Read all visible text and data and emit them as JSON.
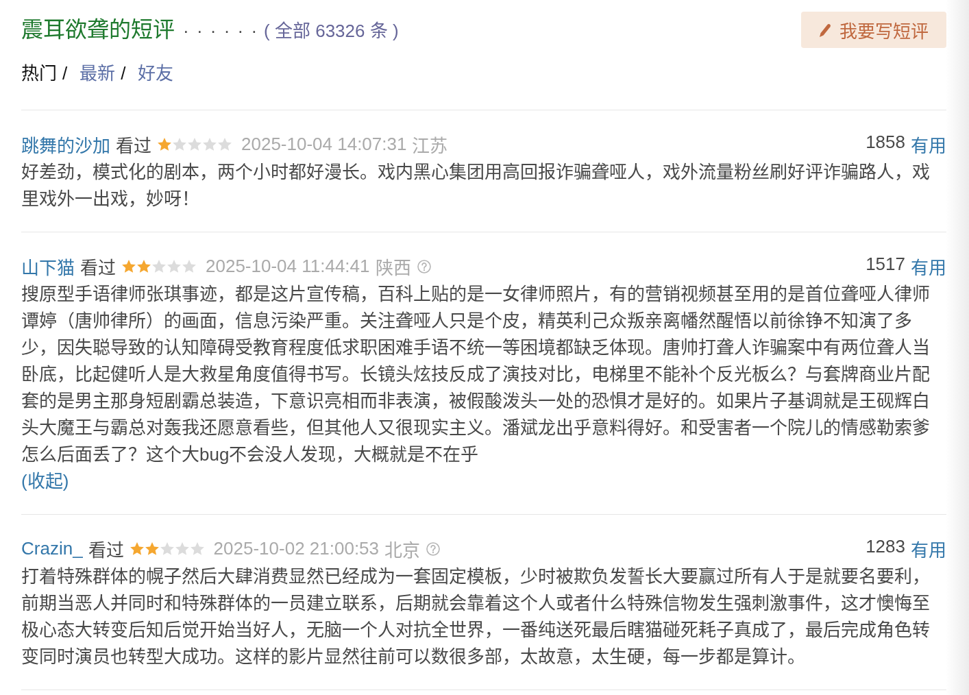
{
  "header": {
    "title": "震耳欲聋的短评",
    "leader": "· · · · · ·",
    "all_link": "( 全部 63326 条 )",
    "write_button": "我要写短评"
  },
  "tabs": [
    {
      "label": "热门",
      "selected": true,
      "separator": "/"
    },
    {
      "label": "最新",
      "selected": false,
      "separator": "/"
    },
    {
      "label": "好友",
      "selected": false
    }
  ],
  "reviews": [
    {
      "user": "跳舞的沙加",
      "status": "看过",
      "stars": 1,
      "time": "2025-10-04 14:07:31",
      "location": "江苏",
      "help_icon": false,
      "votes": "1858",
      "useful_label": "有用",
      "text": "好差劲，模式化的剧本，两个小时都好漫长。戏内黑心集团用高回报诈骗聋哑人，戏外流量粉丝刷好评诈骗路人，戏里戏外一出戏，妙呀！"
    },
    {
      "user": "山下猫",
      "status": "看过",
      "stars": 2,
      "time": "2025-10-04 11:44:41",
      "location": "陕西",
      "help_icon": true,
      "votes": "1517",
      "useful_label": "有用",
      "text": "搜原型手语律师张琪事迹，都是这片宣传稿，百科上贴的是一女律师照片，有的营销视频甚至用的是首位聋哑人律师谭婷（唐帅律所）的画面，信息污染严重。关注聋哑人只是个皮，精英利己众叛亲离幡然醒悟以前徐铮不知演了多少，因失聪导致的认知障碍受教育程度低求职困难手语不统一等困境都缺乏体现。唐帅打聋人诈骗案中有两位聋人当卧底，比起健听人是大救星角度值得书写。长镜头炫技反成了演技对比，电梯里不能补个反光板么？与套牌商业片配套的是男主那身短剧霸总装造，下意识亮相而非表演，被假酸泼头一处的恐惧才是好的。如果片子基调就是王砚辉白头大魔王与霸总对轰我还愿意看些，但其他人又很现实主义。潘斌龙出乎意料得好。和受害者一个院儿的情感勒索爹怎么后面丢了？这个大bug不会没人发现，大概就是不在乎",
      "toggle": "(收起)"
    },
    {
      "user": "Crazin_",
      "status": "看过",
      "stars": 2,
      "time": "2025-10-02 21:00:53",
      "location": "北京",
      "help_icon": true,
      "votes": "1283",
      "useful_label": "有用",
      "text": "打着特殊群体的幌子然后大肆消费显然已经成为一套固定模板，少时被欺负发誓长大要赢过所有人于是就要名要利，前期当恶人并同时和特殊群体的一员建立联系，后期就会靠着这个人或者什么特殊信物发生强刺激事件，这才懊悔至极心态大转变后知后觉开始当好人，无脑一个人对抗全世界，一番纯送死最后瞎猫碰死耗子真成了，最后完成角色转变同时演员也转型大成功。这样的影片显然往前可以数很多部，太故意，太生硬，每一步都是算计。"
    }
  ]
}
